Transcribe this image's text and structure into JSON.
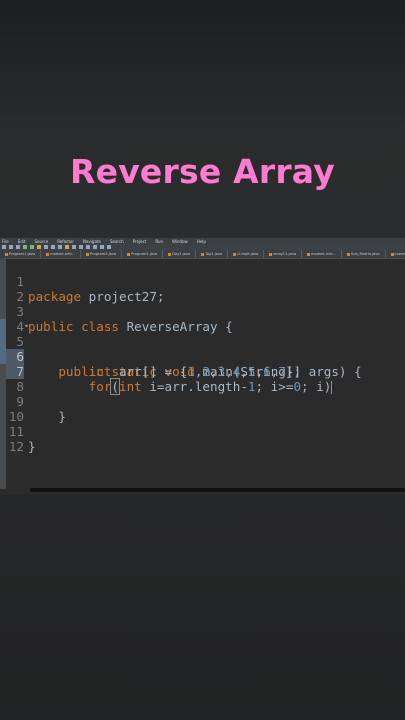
{
  "title": {
    "text": "Reverse Array",
    "color": "#ff7ad1"
  },
  "ide": {
    "menu": [
      "File",
      "Edit",
      "Source",
      "Refactor",
      "Navigate",
      "Search",
      "Project",
      "Run",
      "Window",
      "Help"
    ],
    "tabs": [
      "Program1.java",
      "module-info...",
      "Program3.java",
      "Program2.java",
      "Day1.java",
      "Top1.java",
      "Li.mpit.java",
      "array11.java",
      "module-info...",
      "Sub_Matrix.java",
      "Lower Triang..."
    ],
    "code": {
      "lines": [
        {
          "n": "1",
          "text": [
            "package",
            " project27;"
          ]
        },
        {
          "n": "2"
        },
        {
          "n": "3",
          "text": [
            "public",
            " ",
            "class",
            " ReverseArray {"
          ]
        },
        {
          "n": "4"
        },
        {
          "n": "5",
          "fold": "•",
          "text": [
            "    ",
            "public",
            " ",
            "static",
            " ",
            "void",
            " main(String[] args) {"
          ]
        },
        {
          "n": "6",
          "text": [
            "        ",
            "int",
            " arr[] = {",
            "1",
            ",",
            "2",
            ",",
            "3",
            ",",
            "4",
            ",",
            "5",
            ",",
            "6",
            ",",
            "7",
            "};"
          ]
        },
        {
          "n": "7",
          "text": [
            "        ",
            "for",
            "(",
            "int",
            " i=arr.length-",
            "1",
            "; i>=",
            "0",
            "; i)"
          ]
        },
        {
          "n": "8"
        },
        {
          "n": "9",
          "text": [
            "    }"
          ]
        },
        {
          "n": "10"
        },
        {
          "n": "11",
          "text": [
            "}"
          ]
        },
        {
          "n": "12"
        }
      ]
    }
  }
}
